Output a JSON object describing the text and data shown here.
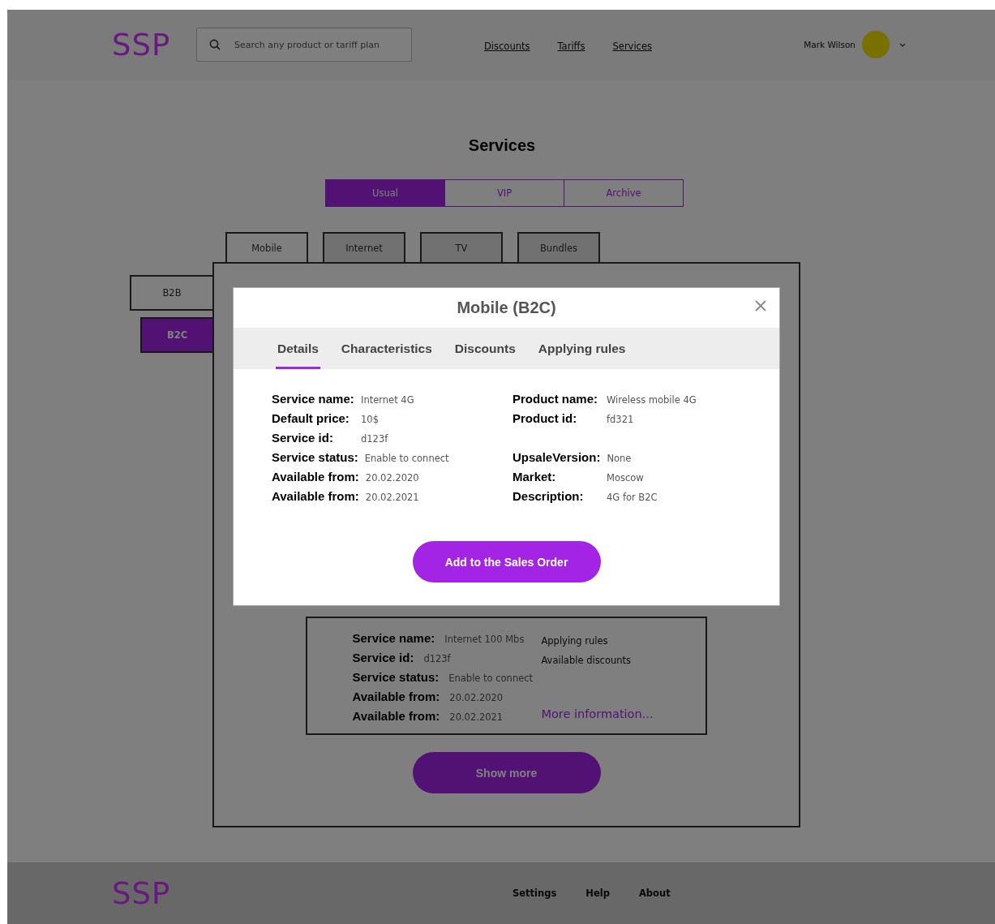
{
  "header": {
    "logo": "SSP",
    "search": {
      "placeholder": "Search any product or tariff plan"
    },
    "nav": [
      {
        "label": "Discounts"
      },
      {
        "label": "Tariffs"
      },
      {
        "label": "Services"
      }
    ],
    "user": {
      "name": "Mark Wilson"
    }
  },
  "page_title": "Services",
  "segments": [
    {
      "label": "Usual",
      "selected": true
    },
    {
      "label": "VIP",
      "selected": false
    },
    {
      "label": "Archive",
      "selected": false
    }
  ],
  "categories": [
    {
      "label": "Mobile",
      "selected": true
    },
    {
      "label": "Internet",
      "selected": false
    },
    {
      "label": "TV",
      "selected": false
    },
    {
      "label": "Bundles",
      "selected": false
    }
  ],
  "customer_types": [
    {
      "label": "B2B",
      "selected": false
    },
    {
      "label": "B2C",
      "selected": true
    }
  ],
  "service_card": {
    "fields": [
      {
        "label": "Service name:",
        "value": "Internet 100 Mbs"
      },
      {
        "label": "Service id:",
        "value": "d123f"
      },
      {
        "label": "Service status:",
        "value": "Enable to connect"
      },
      {
        "label": "Available from:",
        "value": "20.02.2020"
      },
      {
        "label": "Available from:",
        "value": "20.02.2021"
      }
    ],
    "links": [
      "Applying rules",
      "Available discounts"
    ],
    "more_link": "More information..."
  },
  "show_more": "Show more",
  "modal": {
    "title": "Mobile (B2C)",
    "tabs": [
      {
        "label": "Details",
        "selected": true
      },
      {
        "label": "Characteristics",
        "selected": false
      },
      {
        "label": "Discounts",
        "selected": false
      },
      {
        "label": "Applying rules",
        "selected": false
      }
    ],
    "rows": [
      {
        "left": {
          "label": "Service name:",
          "value": "Internet 4G"
        },
        "right": {
          "label": "Product name:",
          "value": "Wireless mobile 4G"
        }
      },
      {
        "left": {
          "label": "Default price:",
          "value": "10$"
        },
        "right": {
          "label": "Product id:",
          "value": "fd321"
        }
      },
      {
        "left": {
          "label": "Service id:",
          "value": "d123f"
        }
      },
      {
        "left": {
          "label": "Service status:",
          "value": "Enable to connect"
        },
        "right": {
          "label": "UpsaleVersion:",
          "value": "None"
        }
      },
      {
        "left": {
          "label": "Available from:",
          "value": "20.02.2020"
        },
        "right": {
          "label": "Market:",
          "value": "Moscow"
        }
      },
      {
        "left": {
          "label": "Available from:",
          "value": "20.02.2021"
        },
        "right": {
          "label": "Description:",
          "value": "4G for B2C"
        }
      }
    ],
    "button": "Add to the Sales Order"
  },
  "footer": {
    "logo": "SSP",
    "links": [
      "Settings",
      "Help",
      "About"
    ]
  }
}
